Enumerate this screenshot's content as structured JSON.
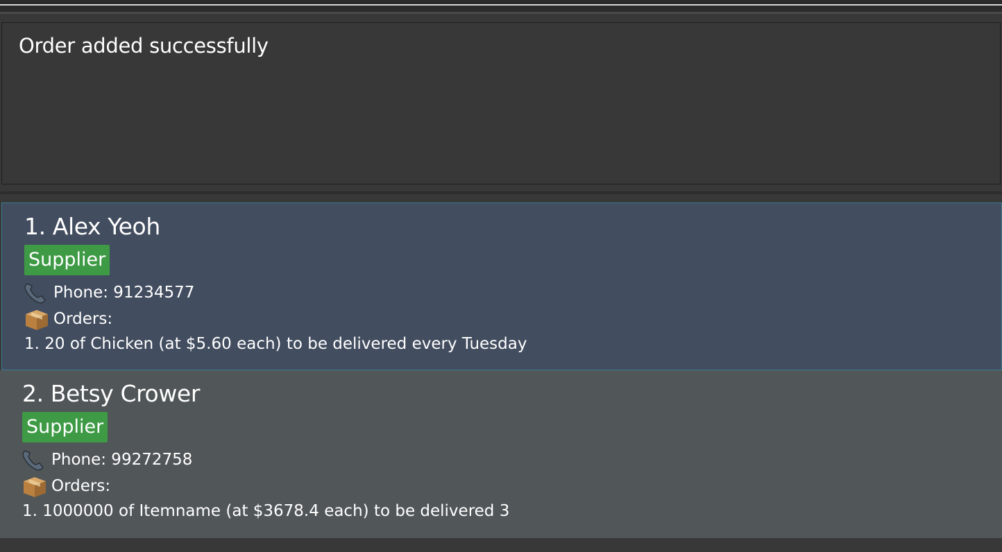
{
  "result": {
    "message": "Order added successfully"
  },
  "persons": [
    {
      "name": "1. Alex Yeoh",
      "tag": "Supplier",
      "phone": "Phone: 91234577",
      "orders_label": "Orders:",
      "orders": [
        "1. 20 of Chicken (at $5.60 each) to be delivered every Tuesday"
      ],
      "selected": true
    },
    {
      "name": "2. Betsy Crower",
      "tag": "Supplier",
      "phone": "Phone: 99272758",
      "orders_label": "Orders:",
      "orders": [
        "1. 1000000 of Itemname (at $3678.4 each) to be delivered 3"
      ],
      "selected": false
    }
  ],
  "colors": {
    "tag_green": "#3e9a45",
    "selected_card": "#424d5f",
    "normal_card": "#515658",
    "background": "#383838"
  },
  "icons": {
    "phone": "phone-icon",
    "orders": "package-icon"
  }
}
